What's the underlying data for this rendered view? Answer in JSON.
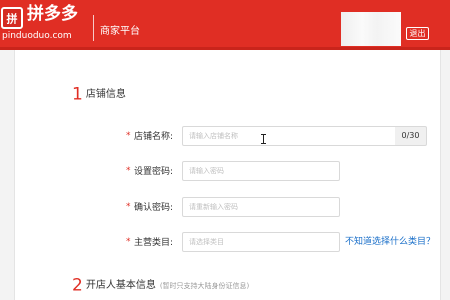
{
  "header": {
    "brand_name": "拼多多",
    "logo_glyph": "拼",
    "domain": "pinduoduo.com",
    "platform": "商家平台",
    "logout_label": "退出",
    "brand_color": "#e02e24"
  },
  "sections": [
    {
      "number": "1",
      "title": "店铺信息"
    },
    {
      "number": "2",
      "title": "开店人基本信息",
      "note": "(暂时只支持大陆身份证信息)"
    }
  ],
  "form": {
    "required_mark": "*",
    "shop_name": {
      "label": "店铺名称:",
      "placeholder": "请输入店铺名称",
      "counter": "0/30"
    },
    "password": {
      "label": "设置密码:",
      "placeholder": "请输入密码"
    },
    "confirm_password": {
      "label": "确认密码:",
      "placeholder": "请重新输入密码"
    },
    "main_category": {
      "label": "主营类目:",
      "placeholder": "请选择类目",
      "help_link": "不知道选择什么类目？"
    }
  }
}
